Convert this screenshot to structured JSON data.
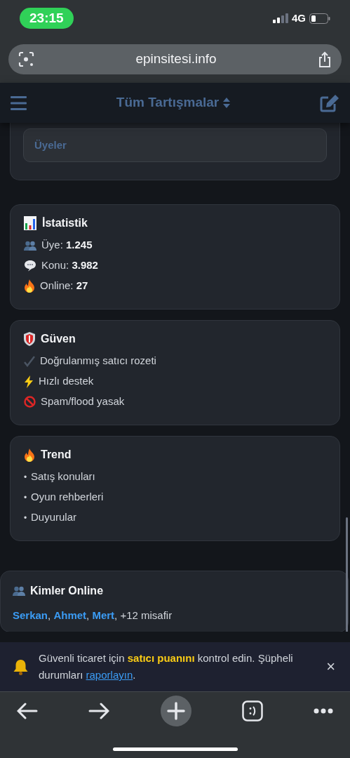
{
  "status_bar": {
    "time": "23:15",
    "network": "4G"
  },
  "address_bar": {
    "url": "epinsitesi.info"
  },
  "header": {
    "title": "Tüm Tartışmalar"
  },
  "members_card": {
    "field_label": "Üyeler"
  },
  "cards": [
    {
      "title": "İstatistik",
      "kind": "chart",
      "items": [
        {
          "kind": "people",
          "label": "Üye:",
          "value": "1.245"
        },
        {
          "kind": "speech",
          "label": "Konu:",
          "value": "3.982"
        },
        {
          "kind": "fire",
          "label": "Online:",
          "value": "27"
        }
      ]
    },
    {
      "title": "Güven",
      "kind": "shield",
      "items": [
        {
          "kind": "check",
          "label": "Doğrulanmış satıcı rozeti"
        },
        {
          "kind": "bolt",
          "label": "Hızlı destek"
        },
        {
          "kind": "prohibited",
          "label": "Spam/flood yasak"
        }
      ]
    },
    {
      "title": "Trend",
      "kind": "fire",
      "items": [
        {
          "kind": "bullet",
          "bullet": "•",
          "label": "Satış konuları"
        },
        {
          "kind": "bullet",
          "bullet": "•",
          "label": "Oyun rehberleri"
        },
        {
          "kind": "bullet",
          "bullet": "•",
          "label": "Duyurular"
        }
      ]
    }
  ],
  "online": {
    "title": "Kimler Online",
    "users": [
      "Serkan",
      "Ahmet",
      "Mert"
    ],
    "separator": ",",
    "guests": "+12 misafir"
  },
  "notice": {
    "text": "Güvenli ticaret için **satıcı puanını** kontrol edin. Şüpheli durumları",
    "link": "raporlayın",
    "after": ".",
    "close": "×"
  }
}
